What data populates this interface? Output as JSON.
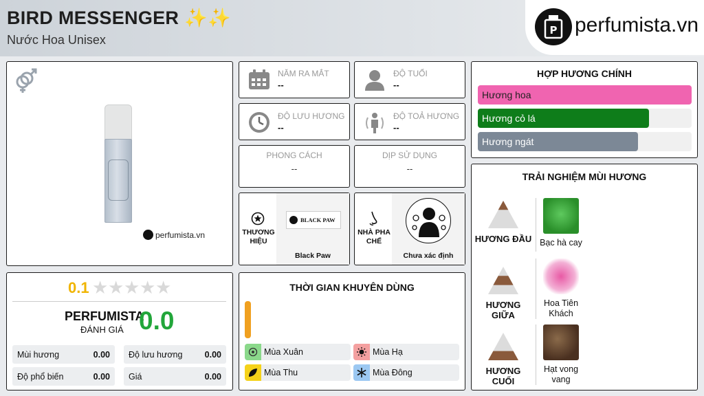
{
  "header": {
    "title": "BIRD MESSENGER ✨✨",
    "subtitle": "Nước Hoa Unisex"
  },
  "brand": {
    "site": "perfumista.vn"
  },
  "product": {
    "watermark": "perfumista.vn",
    "gender_icon": "unisex-gender-icon"
  },
  "rating": {
    "score": "0.1",
    "stars_filled_fraction": 0.02,
    "label": "PERFUMISTA",
    "sub_label": "ĐÁNH GIÁ",
    "pf_score": "0.0",
    "metrics": [
      {
        "label": "Mùi hương",
        "value": "0.00"
      },
      {
        "label": "Độ lưu hương",
        "value": "0.00"
      },
      {
        "label": "Độ phổ biến",
        "value": "0.00"
      },
      {
        "label": "Giá",
        "value": "0.00"
      }
    ]
  },
  "info": {
    "year": {
      "label": "NĂM RA MẮT",
      "value": "--"
    },
    "age": {
      "label": "ĐỘ TUỔI",
      "value": "--"
    },
    "longevity": {
      "label": "ĐỘ LƯU HƯƠNG",
      "value": "--"
    },
    "sillage": {
      "label": "ĐỘ TOẢ HƯƠNG",
      "value": "--"
    },
    "style": {
      "label": "PHONG CÁCH",
      "value": "--"
    },
    "occasion": {
      "label": "DỊP SỬ DỤNG",
      "value": "--"
    },
    "brand": {
      "label": "THƯƠNG HIỆU",
      "logo_text": "BLACK PAW",
      "name": "Black Paw"
    },
    "perfumer": {
      "label": "NHÀ PHA CHẾ",
      "name": "Chưa xác định"
    }
  },
  "accords": {
    "title": "HỢP HƯƠNG CHÍNH",
    "items": [
      {
        "label": "Hương hoa",
        "value": 100,
        "color": "#f064b0"
      },
      {
        "label": "Hương cỏ lá",
        "value": 80,
        "color": "#0e7d1a"
      },
      {
        "label": "Hương ngát",
        "value": 75,
        "color": "#7c8896"
      }
    ]
  },
  "pyramid": {
    "title": "TRẢI NGHIỆM MÙI HƯƠNG",
    "top": {
      "label": "HƯƠNG ĐẦU",
      "note": "Bạc hà cay"
    },
    "middle": {
      "label": "HƯƠNG GIỮA",
      "note_line1": "Hoa Tiên",
      "note_line2": "Khách"
    },
    "base": {
      "label": "HƯƠNG CUỐI",
      "note_line1": "Hạt vong",
      "note_line2": "vang"
    }
  },
  "seasons": {
    "title": "THỜI GIAN KHUYÊN DÙNG",
    "level": 0.5,
    "bar_color": "#f0a020",
    "items": [
      {
        "label": "Mùa Xuân",
        "color": "#8bd98b"
      },
      {
        "label": "Mùa Hạ",
        "color": "#f4a0a0"
      },
      {
        "label": "Mùa Thu",
        "color": "#f5d21a"
      },
      {
        "label": "Mùa Đông",
        "color": "#9cc8f2"
      }
    ]
  }
}
